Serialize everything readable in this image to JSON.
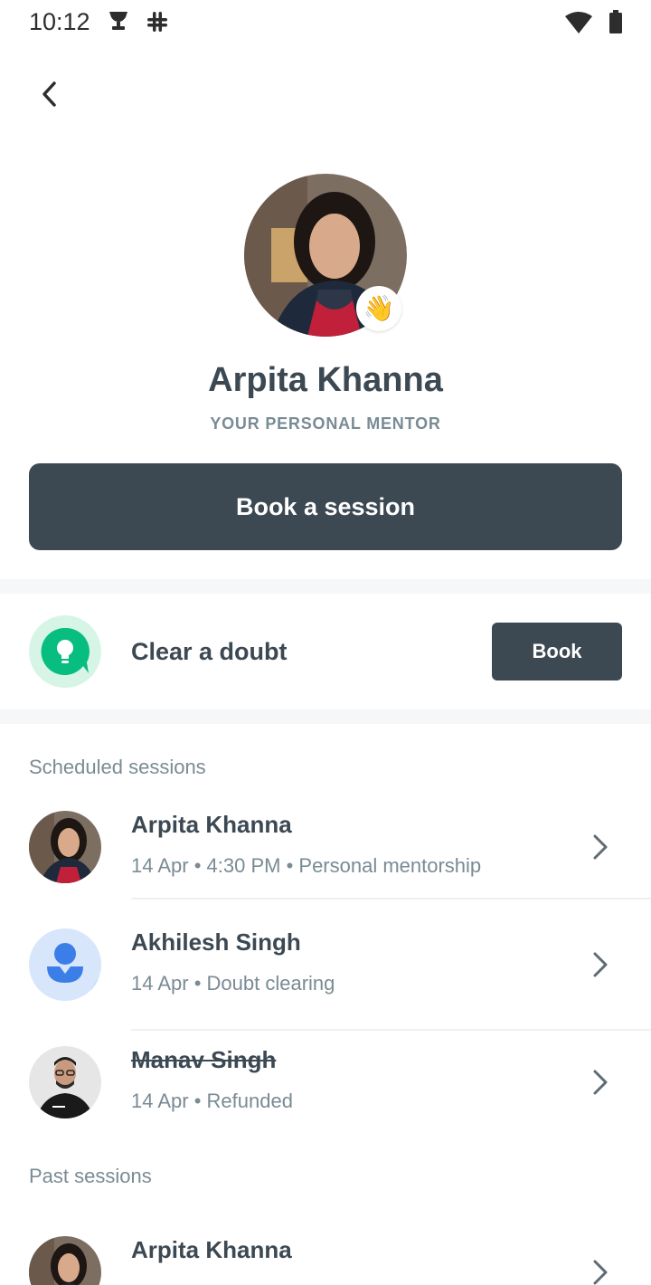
{
  "status_bar": {
    "time": "10:12",
    "icons": [
      "trophy-icon",
      "slack-icon",
      "wifi-icon",
      "battery-icon"
    ]
  },
  "header": {
    "back_icon": "chevron-left-icon"
  },
  "mentor": {
    "name": "Arpita Khanna",
    "subtitle": "YOUR PERSONAL MENTOR",
    "badge_emoji": "👋",
    "book_session_label": "Book a session"
  },
  "doubt": {
    "label": "Clear a doubt",
    "button_label": "Book",
    "icon": "lightbulb-chat-icon"
  },
  "scheduled": {
    "title": "Scheduled sessions",
    "items": [
      {
        "name": "Arpita Khanna",
        "meta": "14 Apr • 4:30 PM • Personal mentorship",
        "struck": false
      },
      {
        "name": "Akhilesh Singh",
        "meta": "14 Apr • Doubt clearing",
        "struck": false
      },
      {
        "name": "Manav Singh",
        "meta": "14 Apr • Refunded",
        "struck": true
      }
    ]
  },
  "past": {
    "title": "Past sessions",
    "items": [
      {
        "name": "Arpita Khanna"
      }
    ]
  },
  "colors": {
    "primary_dark": "#3c4852",
    "muted_text": "#7a8b94",
    "doubt_green": "#08bd80",
    "doubt_bg": "#d6f5e7",
    "placeholder_blue": "#3c7ee8"
  }
}
